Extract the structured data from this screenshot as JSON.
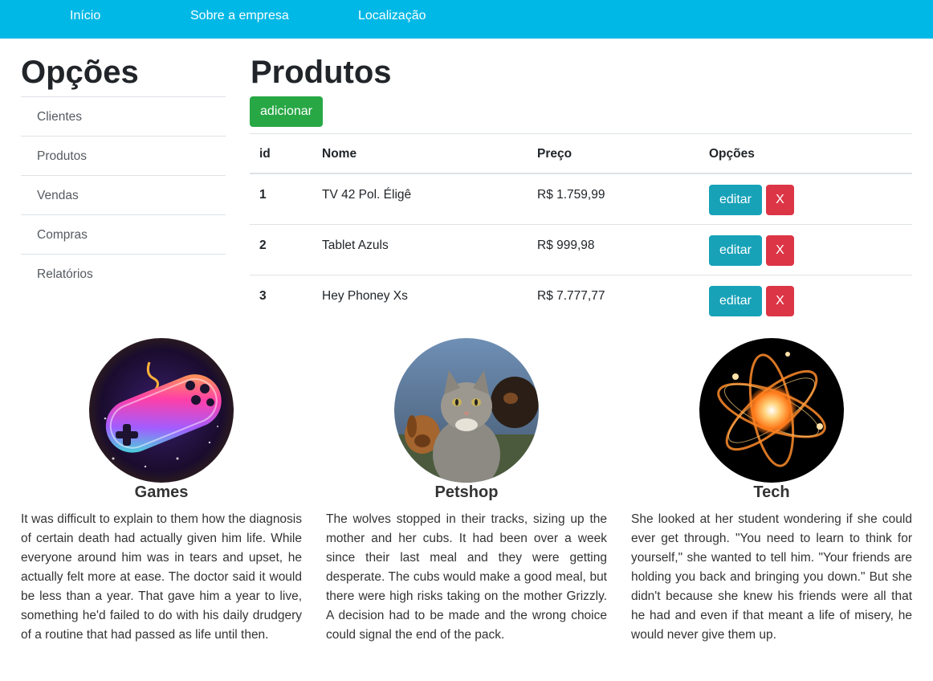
{
  "nav": {
    "items": [
      "Início",
      "Sobre a empresa",
      "Localização"
    ]
  },
  "sidebar": {
    "title": "Opções",
    "items": [
      "Clientes",
      "Produtos",
      "Vendas",
      "Compras",
      "Relatórios"
    ]
  },
  "main": {
    "title": "Produtos",
    "add_label": "adicionar",
    "table": {
      "headers": [
        "id",
        "Nome",
        "Preço",
        "Opções"
      ],
      "rows": [
        {
          "id": "1",
          "nome": "TV 42 Pol. Éligê",
          "preco": "R$ 1.759,99"
        },
        {
          "id": "2",
          "nome": "Tablet Azuls",
          "preco": "R$ 999,98"
        },
        {
          "id": "3",
          "nome": "Hey Phoney Xs",
          "preco": "R$ 7.777,77"
        }
      ],
      "edit_label": "editar",
      "delete_label": "X"
    }
  },
  "cards": [
    {
      "title": "Games",
      "image": "gamepad-neon-image",
      "text": "It was difficult to explain to them how the diagnosis of certain death had actually given him life. While everyone around him was in tears and upset, he actually felt more at ease. The doctor said it would be less than a year. That gave him a year to live, something he'd failed to do with his daily drudgery of a routine that had passed as life until then."
    },
    {
      "title": "Petshop",
      "image": "cat-and-dogs-photo",
      "text": "The wolves stopped in their tracks, sizing up the mother and her cubs. It had been over a week since their last meal and they were getting desperate. The cubs would make a good meal, but there were high risks taking on the mother Grizzly. A decision had to be made and the wrong choice could signal the end of the pack."
    },
    {
      "title": "Tech",
      "image": "atom-glow-image",
      "text": "She looked at her student wondering if she could ever get through. \"You need to learn to think for yourself,\" she wanted to tell him. \"Your friends are holding you back and bringing you down.\" But she didn't because she knew his friends were all that he had and even if that meant a life of misery, he would never give them up."
    }
  ],
  "colors": {
    "navbar": "#00b8e6",
    "add_button": "#28a745",
    "edit_button": "#17a2b8",
    "delete_button": "#dc3545"
  }
}
